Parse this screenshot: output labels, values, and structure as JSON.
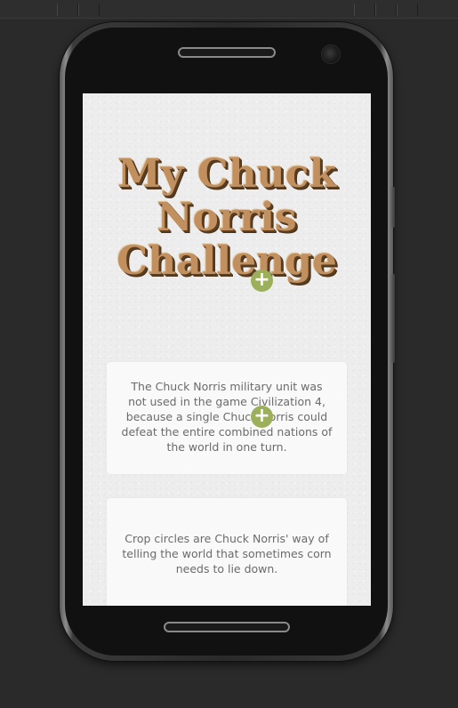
{
  "app": {
    "title": "My Chuck Norris Challenge"
  },
  "cards": [
    {
      "text": "The Chuck Norris military unit was not used in the game Civilization 4, because a single Chuck Norris could defeat the entire combined nations of the world in one turn.",
      "action_icon": "plus-icon"
    },
    {
      "text": "Crop circles are Chuck Norris' way of telling the world that sometimes corn needs to lie down.",
      "action_icon": "plus-icon"
    }
  ],
  "theme": {
    "title_color": "#c2905f",
    "title_shadow": "#5a3e22",
    "accent": "#9cb05b",
    "card_bg": "#f9f9f9",
    "card_text": "#6b6b6b",
    "screen_bg": "#ededed",
    "device_bg": "#111111",
    "page_bg": "#2a2a2a"
  }
}
